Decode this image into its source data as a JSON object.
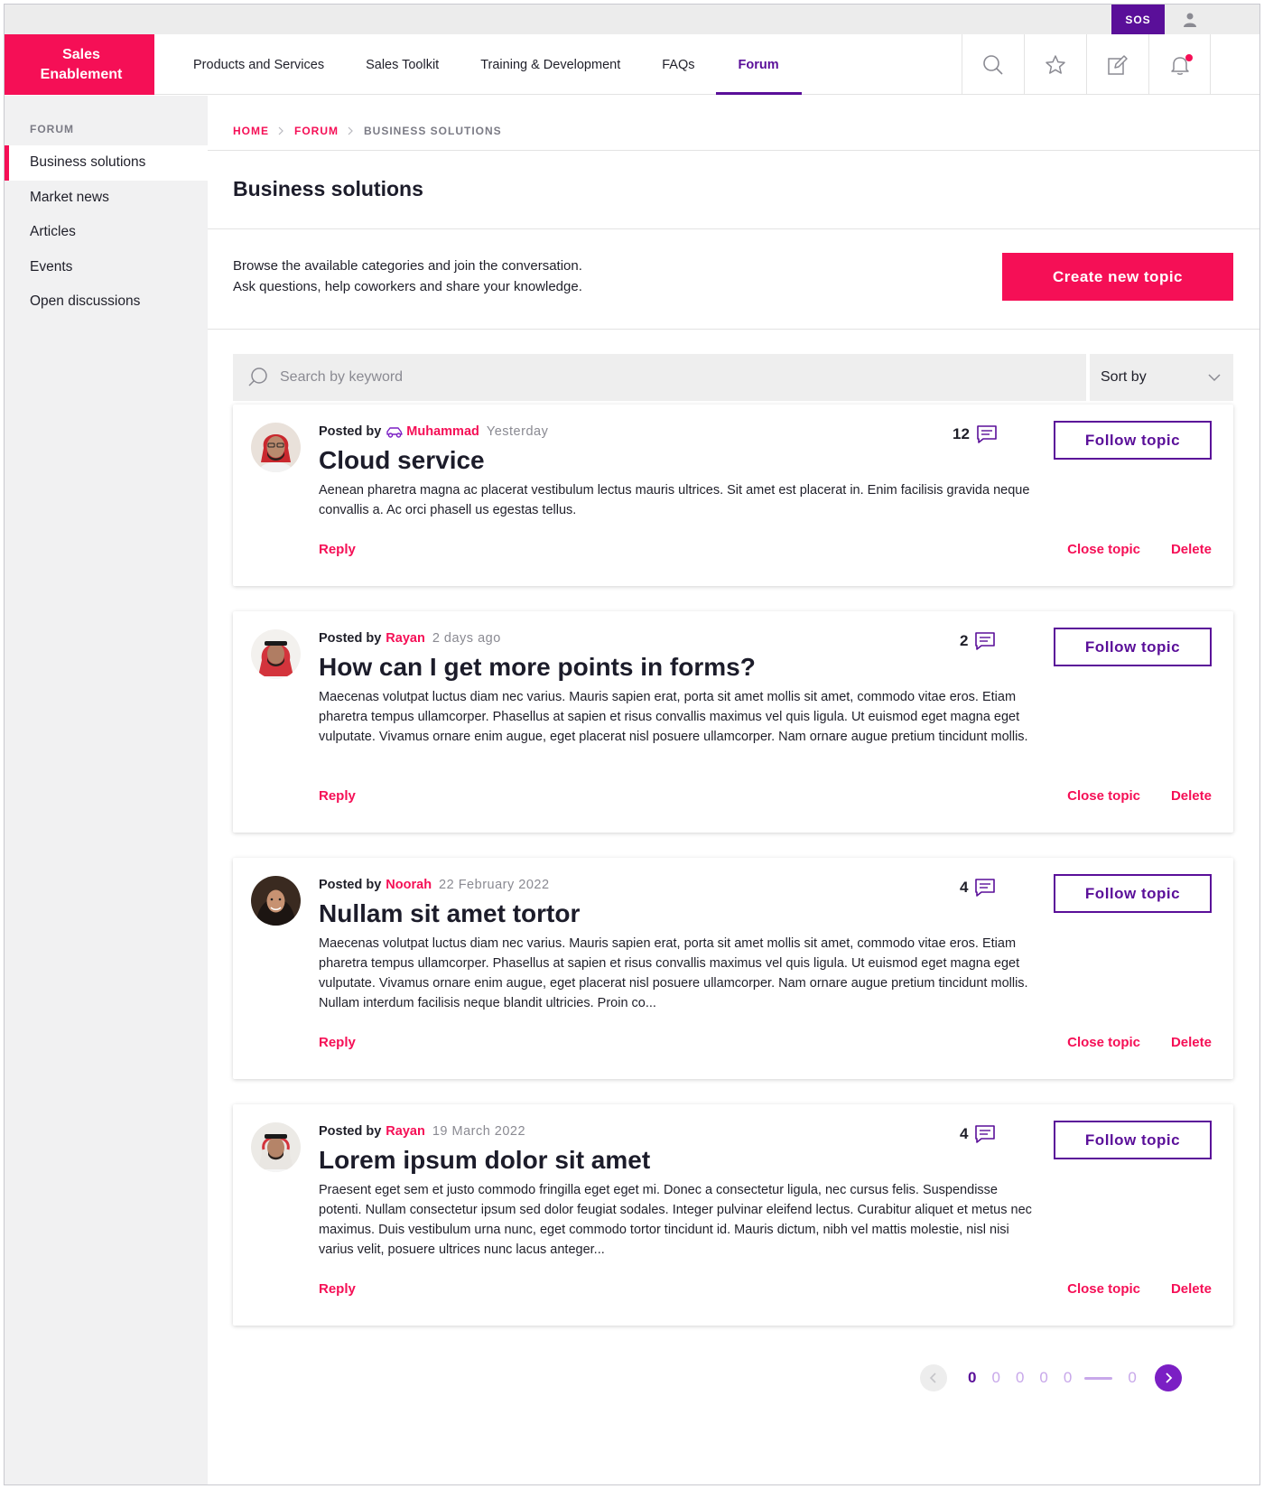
{
  "utility": {
    "sos_label": "SOS"
  },
  "brand": {
    "line1": "Sales",
    "line2": "Enablement"
  },
  "nav": {
    "items": [
      {
        "label": "Products and Services"
      },
      {
        "label": "Sales Toolkit"
      },
      {
        "label": "Training & Development"
      },
      {
        "label": "FAQs"
      },
      {
        "label": "Forum",
        "active": true
      }
    ]
  },
  "header_icons": [
    "search-icon",
    "star-icon",
    "edit-icon",
    "bell-icon"
  ],
  "sidebar": {
    "heading": "FORUM",
    "items": [
      {
        "label": "Business solutions",
        "active": true
      },
      {
        "label": "Market news"
      },
      {
        "label": "Articles"
      },
      {
        "label": "Events"
      },
      {
        "label": "Open discussions"
      }
    ]
  },
  "breadcrumb": {
    "home": "HOME",
    "forum": "FORUM",
    "current": "BUSINESS SOLUTIONS"
  },
  "page": {
    "title": "Business solutions",
    "intro_line1": "Browse the available categories and join the conversation.",
    "intro_line2": "Ask questions, help coworkers and share your knowledge.",
    "create_label": "Create new topic"
  },
  "search": {
    "placeholder": "Search by keyword",
    "sort_label": "Sort by"
  },
  "labels": {
    "posted_by": "Posted by",
    "follow": "Follow topic",
    "reply": "Reply",
    "close": "Close topic",
    "delete": "Delete"
  },
  "topics": [
    {
      "author": "Muhammad",
      "date": "Yesterday",
      "title": "Cloud service",
      "body": "Aenean pharetra magna ac placerat vestibulum lectus mauris ultrices. Sit amet est placerat in. Enim facilisis gravida neque convallis a. Ac orci phasell us egestas tellus.",
      "comments": "12"
    },
    {
      "author": "Rayan",
      "date": "2 days ago",
      "title": "How can I get more points in forms?",
      "body": "Maecenas volutpat luctus diam nec varius. Mauris sapien erat, porta sit amet mollis sit amet, commodo vitae eros. Etiam pharetra tempus ullamcorper. Phasellus at sapien et risus convallis maximus vel quis ligula. Ut euismod eget magna eget vulputate. Vivamus ornare enim augue, eget placerat nisl posuere ullamcorper. Nam ornare augue pretium tincidunt mollis.",
      "comments": "2"
    },
    {
      "author": "Noorah",
      "date": "22 February 2022",
      "title": "Nullam sit amet tortor",
      "body": "Maecenas volutpat luctus diam nec varius. Mauris sapien erat, porta sit amet mollis sit amet, commodo vitae eros. Etiam pharetra tempus ullamcorper. Phasellus at sapien et risus convallis maximus vel quis ligula. Ut euismod eget magna eget vulputate. Vivamus ornare enim augue, eget placerat nisl posuere ullamcorper. Nam ornare augue pretium tincidunt mollis. Nullam interdum facilisis neque blandit ultricies. Proin co...",
      "comments": "4"
    },
    {
      "author": "Rayan",
      "date": "19 March 2022",
      "title": "Lorem ipsum dolor sit amet",
      "body": "Praesent eget sem et justo commodo fringilla eget eget mi. Donec a consectetur ligula, nec cursus felis. Suspendisse potenti. Nullam consectetur ipsum sed dolor feugiat sodales. Integer pulvinar eleifend lectus. Curabitur aliquet et metus nec maximus. Duis vestibulum urna nunc, eget commodo tortor tincidunt id. Mauris dictum, nibh vel mattis molestie, nisl nisi varius velit, posuere ultrices nunc lacus anteger...",
      "comments": "4"
    }
  ],
  "pagination": {
    "pages": [
      "0",
      "0",
      "0",
      "0",
      "0"
    ],
    "last": "0"
  },
  "colors": {
    "brand": "#f50f56",
    "accent": "#5a0f99"
  }
}
